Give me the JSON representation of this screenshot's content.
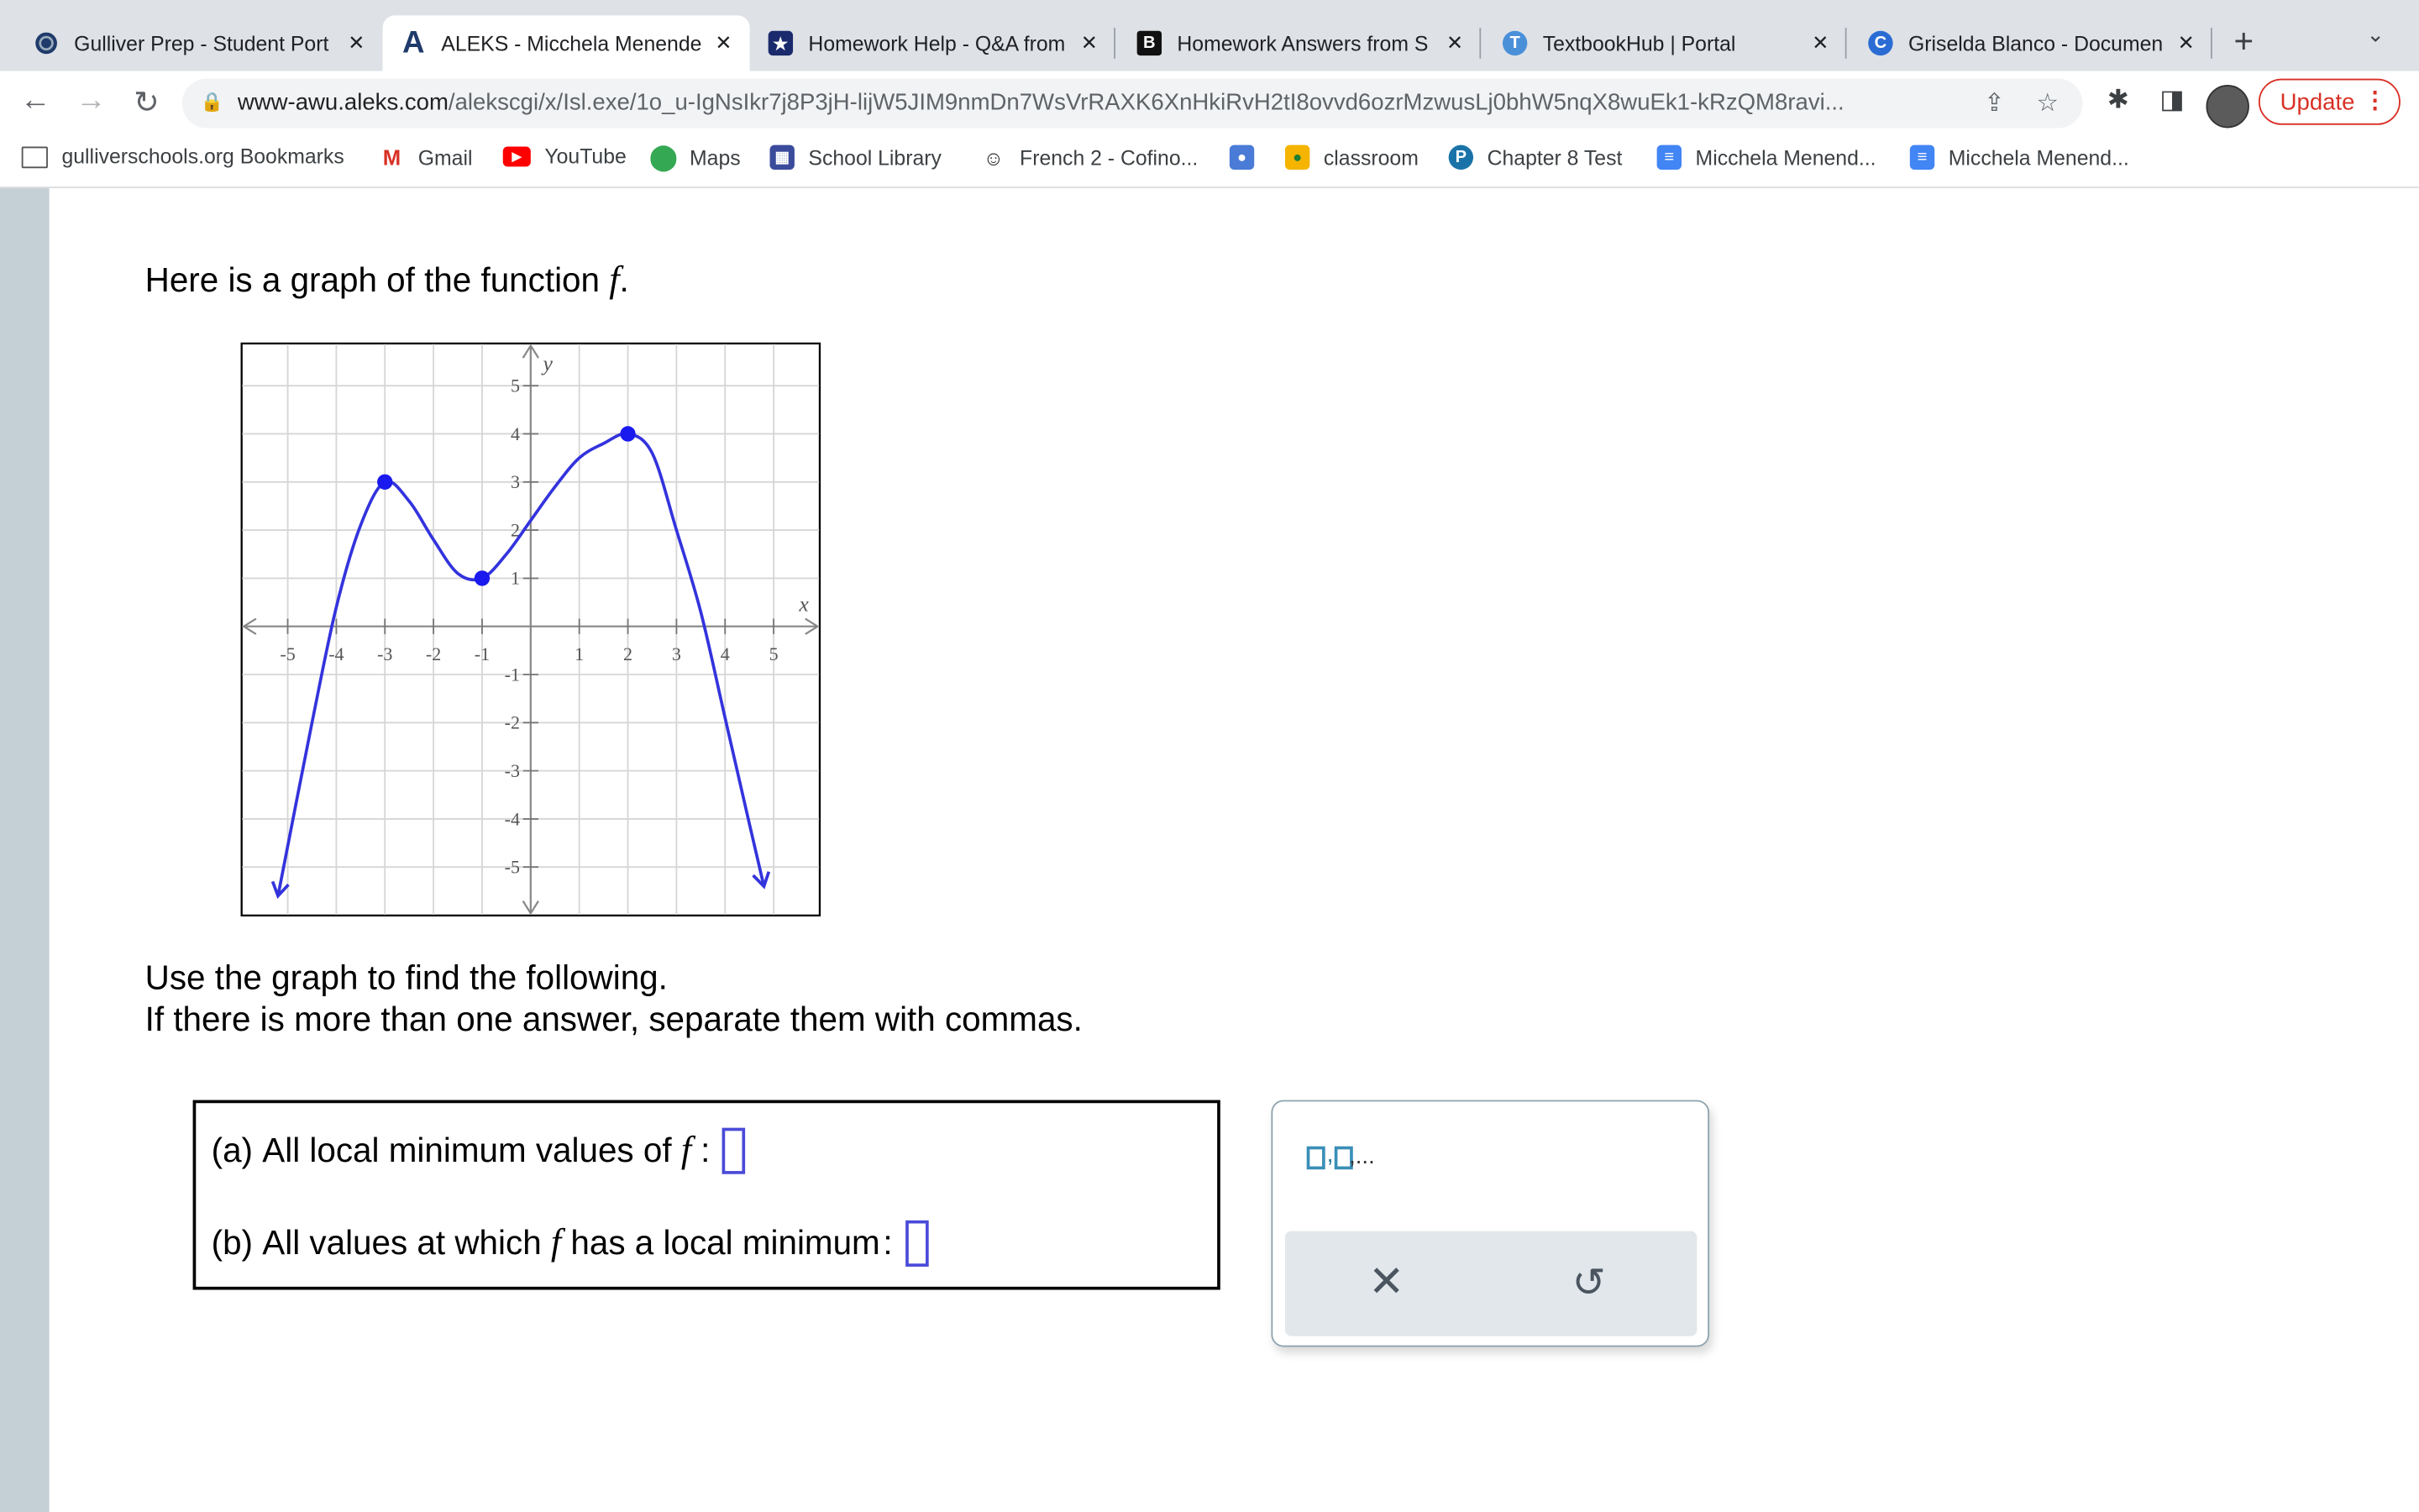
{
  "browser": {
    "tabs": [
      {
        "title": "Gulliver Prep - Student Port",
        "icon": "globe-icon",
        "active": false
      },
      {
        "title": "ALEKS - Micchela Menende",
        "icon": "aleks-icon",
        "active": true
      },
      {
        "title": "Homework Help - Q&A from",
        "icon": "star-icon",
        "active": false
      },
      {
        "title": "Homework Answers from S",
        "icon": "b-icon",
        "active": false
      },
      {
        "title": "TextbookHub | Portal",
        "icon": "textbookhub-icon",
        "active": false
      },
      {
        "title": "Griselda Blanco - Documen",
        "icon": "c-icon",
        "active": false
      }
    ],
    "url_host": "www-awu.aleks.com",
    "url_path": "/alekscgi/x/Isl.exe/1o_u-IgNsIkr7j8P3jH-lijW5JIM9nmDn7WsVrRAXK6XnHkiRvH2tI8ovvd6ozrMzwusLj0bhW5nqX8wuEk1-kRzQM8ravi...",
    "update_label": "Update",
    "bookmarks": [
      {
        "label": "gulliverschools.org Bookmarks",
        "icon": "folder-icon"
      },
      {
        "label": "Gmail",
        "icon": "gmail-icon"
      },
      {
        "label": "YouTube",
        "icon": "youtube-icon"
      },
      {
        "label": "Maps",
        "icon": "maps-icon"
      },
      {
        "label": "School Library",
        "icon": "library-icon"
      },
      {
        "label": "French 2 - Cofino...",
        "icon": "owl-icon"
      },
      {
        "label": "",
        "icon": "contact-icon"
      },
      {
        "label": "classroom",
        "icon": "classroom-icon"
      },
      {
        "label": "Chapter 8 Test",
        "icon": "p-icon"
      },
      {
        "label": "Micchela Menend...",
        "icon": "docs-icon"
      },
      {
        "label": "Micchela Menend...",
        "icon": "docs-icon"
      }
    ]
  },
  "question": {
    "intro": "Here is a graph of the function",
    "func": "f",
    "intro_end": ".",
    "instruction_1": "Use the graph to find the following.",
    "instruction_2": "If there is more than one answer, separate them with commas.",
    "part_a_label": "(a)",
    "part_a_text": "All local minimum values of",
    "part_a_end": ":",
    "part_b_label": "(b)",
    "part_b_text": "All values at which",
    "part_b_mid": "has a local minimum",
    "part_b_end": ":"
  },
  "chart_data": {
    "type": "line",
    "xlabel": "x",
    "ylabel": "y",
    "xlim": [
      -5.5,
      6
    ],
    "ylim": [
      -5.8,
      6
    ],
    "x_ticks": [
      -5,
      -4,
      -3,
      -2,
      -1,
      1,
      2,
      3,
      4,
      5
    ],
    "y_ticks": [
      -5,
      -4,
      -3,
      -2,
      -1,
      1,
      2,
      3,
      4,
      5
    ],
    "grid": true,
    "curve_points": [
      [
        -5.2,
        -5.6
      ],
      [
        -4.5,
        -2
      ],
      [
        -4,
        0.4
      ],
      [
        -3.5,
        2.1
      ],
      [
        -3,
        3
      ],
      [
        -2.5,
        2.6
      ],
      [
        -2,
        1.8
      ],
      [
        -1.5,
        1.1
      ],
      [
        -1,
        1
      ],
      [
        -0.5,
        1.5
      ],
      [
        0,
        2.2
      ],
      [
        0.5,
        2.9
      ],
      [
        1,
        3.5
      ],
      [
        1.5,
        3.8
      ],
      [
        2,
        4
      ],
      [
        2.5,
        3.6
      ],
      [
        3,
        2
      ],
      [
        3.5,
        0.3
      ],
      [
        4,
        -1.9
      ],
      [
        4.5,
        -4.1
      ],
      [
        4.8,
        -5.4
      ]
    ],
    "key_points": [
      [
        -3,
        3
      ],
      [
        -1,
        1
      ],
      [
        2,
        4
      ]
    ],
    "arrows": [
      "down-left",
      "down-right"
    ]
  },
  "panel": {
    "list_symbol": ",...",
    "clear_symbol": "✕",
    "undo_symbol": "↺"
  }
}
